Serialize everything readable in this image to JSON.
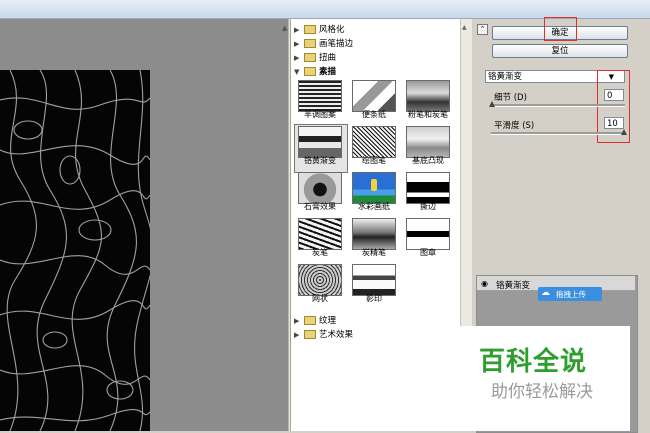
{
  "gallery": {
    "categories_top": [
      {
        "label": "风格化",
        "expanded": false
      },
      {
        "label": "画笔描边",
        "expanded": false
      },
      {
        "label": "扭曲",
        "expanded": false
      },
      {
        "label": "素描",
        "expanded": true
      }
    ],
    "filters": [
      "半调图案",
      "便条纸",
      "粉笔和炭笔",
      "铬黄渐变",
      "绘图笔",
      "基底凸现",
      "石膏效果",
      "水彩画纸",
      "撕边",
      "炭笔",
      "炭精笔",
      "图章",
      "网状",
      "影印"
    ],
    "selected_filter": "铬黄渐变",
    "categories_bottom": [
      {
        "label": "纹理",
        "expanded": false
      },
      {
        "label": "艺术效果",
        "expanded": false
      }
    ]
  },
  "controls": {
    "ok_label": "确定",
    "reset_label": "复位",
    "filter_select": "铬黄渐变",
    "detail_label": "细节 (D)",
    "detail_value": "0",
    "smooth_label": "平滑度 (S)",
    "smooth_value": "10"
  },
  "layers": {
    "layer_name": "铬黄渐变",
    "upload_label": "拖拽上传"
  },
  "watermark": {
    "title": "百科全说",
    "subtitle": "助你轻松解决"
  },
  "colors": {
    "highlight": "#e0302b",
    "watermark_green": "#2e9e2e",
    "upload_blue": "#3b8fe0"
  }
}
